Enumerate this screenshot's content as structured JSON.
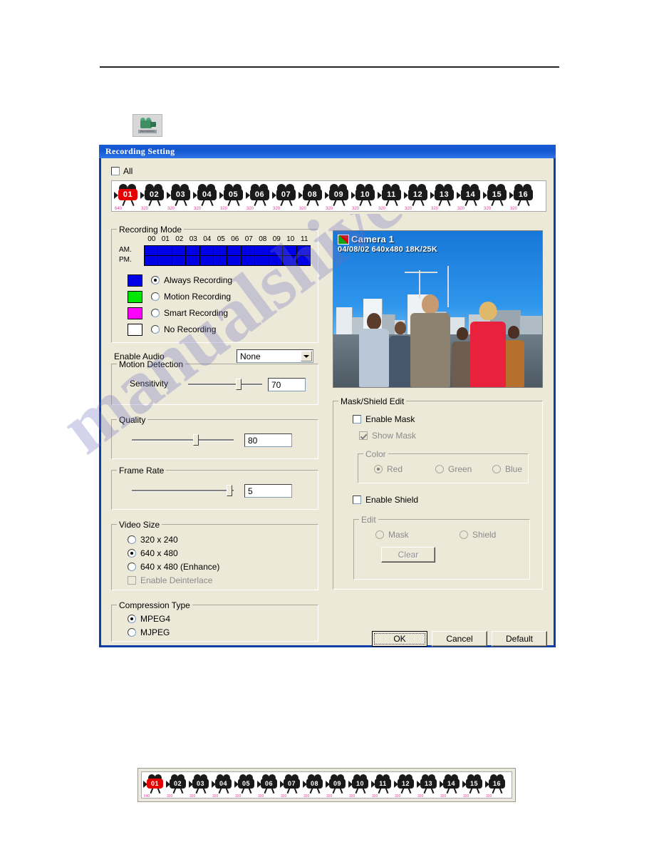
{
  "window": {
    "title": "Recording Setting"
  },
  "toolbar_icon": {
    "name": "recording-camera-icon",
    "caption": "RECORDING"
  },
  "all_checkbox": {
    "label": "All",
    "checked": false
  },
  "cameras": [
    {
      "num": "01",
      "res": "640",
      "active": true
    },
    {
      "num": "02",
      "res": "320",
      "active": false
    },
    {
      "num": "03",
      "res": "320",
      "active": false
    },
    {
      "num": "04",
      "res": "320",
      "active": false
    },
    {
      "num": "05",
      "res": "320",
      "active": false
    },
    {
      "num": "06",
      "res": "320",
      "active": false
    },
    {
      "num": "07",
      "res": "320",
      "active": false
    },
    {
      "num": "08",
      "res": "320",
      "active": false
    },
    {
      "num": "09",
      "res": "320",
      "active": false
    },
    {
      "num": "10",
      "res": "320",
      "active": false
    },
    {
      "num": "11",
      "res": "320",
      "active": false
    },
    {
      "num": "12",
      "res": "320",
      "active": false
    },
    {
      "num": "13",
      "res": "320",
      "active": false
    },
    {
      "num": "14",
      "res": "320",
      "active": false
    },
    {
      "num": "15",
      "res": "320",
      "active": false
    },
    {
      "num": "16",
      "res": "320",
      "active": false
    }
  ],
  "recording_mode": {
    "title": "Recording Mode",
    "hour_labels": [
      "00",
      "01",
      "02",
      "03",
      "04",
      "05",
      "06",
      "07",
      "08",
      "09",
      "10",
      "11"
    ],
    "row_labels": [
      "AM.",
      "PM."
    ],
    "schedule": {
      "am": [
        "always",
        "always",
        "always",
        "always",
        "always",
        "always",
        "always",
        "always",
        "always",
        "always",
        "always",
        "always"
      ],
      "pm": [
        "always",
        "always",
        "always",
        "always",
        "always",
        "always",
        "always",
        "always",
        "always",
        "always",
        "always",
        "always"
      ]
    },
    "options": [
      {
        "label": "Always Recording",
        "color": "#0000e6",
        "selected": true
      },
      {
        "label": "Motion Recording",
        "color": "#00e600",
        "selected": false
      },
      {
        "label": "Smart Recording",
        "color": "#ff00ff",
        "selected": false
      },
      {
        "label": "No Recording",
        "color": "#ffffff",
        "selected": false
      }
    ]
  },
  "enable_audio": {
    "label": "Enable Audio",
    "value": "None",
    "options": [
      "None"
    ]
  },
  "motion_detection": {
    "title": "Motion Detection",
    "slider_label": "Sensitivity",
    "value": "70",
    "percent": 68
  },
  "quality": {
    "title": "Quality",
    "value": "80",
    "percent": 63
  },
  "frame_rate": {
    "title": "Frame Rate",
    "value": "5",
    "percent": 96
  },
  "video_size": {
    "title": "Video Size",
    "options": [
      {
        "label": "320 x 240",
        "selected": false,
        "disabled": false
      },
      {
        "label": "640 x 480",
        "selected": true,
        "disabled": false
      },
      {
        "label": "640 x 480 (Enhance)",
        "selected": false,
        "disabled": false
      }
    ],
    "deinterlace": {
      "label": "Enable Deinterlace",
      "checked": false,
      "disabled": true
    }
  },
  "compression_type": {
    "title": "Compression Type",
    "options": [
      {
        "label": "MPEG4",
        "selected": true
      },
      {
        "label": "MJPEG",
        "selected": false
      }
    ]
  },
  "preview": {
    "camera_name": "Camera 1",
    "info_line": "04/08/02  640x480  18K/25K",
    "flag_icon": "record-flag-icon"
  },
  "mask_shield": {
    "title": "Mask/Shield Edit",
    "enable_mask": {
      "label": "Enable Mask",
      "checked": false,
      "disabled": false
    },
    "show_mask": {
      "label": "Show Mask",
      "checked": true,
      "disabled": true
    },
    "color": {
      "title": "Color",
      "options": [
        {
          "label": "Red",
          "selected": true,
          "disabled": true
        },
        {
          "label": "Green",
          "selected": false,
          "disabled": true
        },
        {
          "label": "Blue",
          "selected": false,
          "disabled": true
        }
      ]
    },
    "enable_shield": {
      "label": "Enable Shield",
      "checked": false,
      "disabled": false
    },
    "edit": {
      "title": "Edit",
      "options": [
        {
          "label": "Mask",
          "selected": false,
          "disabled": true
        },
        {
          "label": "Shield",
          "selected": false,
          "disabled": true
        }
      ],
      "clear_button": {
        "label": "Clear",
        "disabled": true
      }
    }
  },
  "buttons": {
    "ok": "OK",
    "cancel": "Cancel",
    "default": "Default"
  },
  "watermark": {
    "text": "manualshive.com"
  },
  "colors": {
    "title_blue": "#1b5cd6",
    "dialog_face": "#ece9d8",
    "always": "#0000e6",
    "motion": "#00e600",
    "smart": "#ff00ff",
    "none": "#ffffff",
    "active_camera": "#e60000",
    "camera_res_text": "#e0409a"
  }
}
